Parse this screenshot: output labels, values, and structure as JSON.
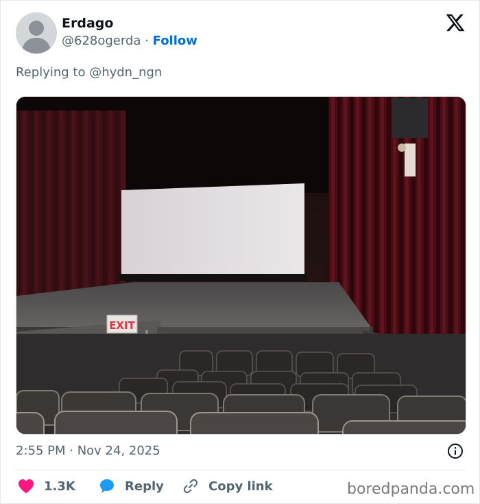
{
  "author": {
    "name": "Erdago",
    "handle": "@628ogerda",
    "separator": "·",
    "follow_label": "Follow"
  },
  "reply_to": "Replying to @hydn_ngn",
  "media": {
    "exit_sign_text": "EXIT"
  },
  "timestamp": "2:55 PM · Nov 24, 2025",
  "actions": {
    "like_count": "1.3K",
    "reply_label": "Reply",
    "copy_label": "Copy link"
  },
  "watermark": "boredpanda.com",
  "icons": {
    "avatar": "default-avatar-icon",
    "logo": "x-logo-icon",
    "info": "info-icon",
    "like": "heart-icon",
    "reply": "speech-bubble-icon",
    "copy": "link-icon"
  },
  "colors": {
    "heart": "#f91880",
    "reply_bubble": "#1d9bf0",
    "follow": "#006fd6",
    "secondary_text": "#536471"
  }
}
